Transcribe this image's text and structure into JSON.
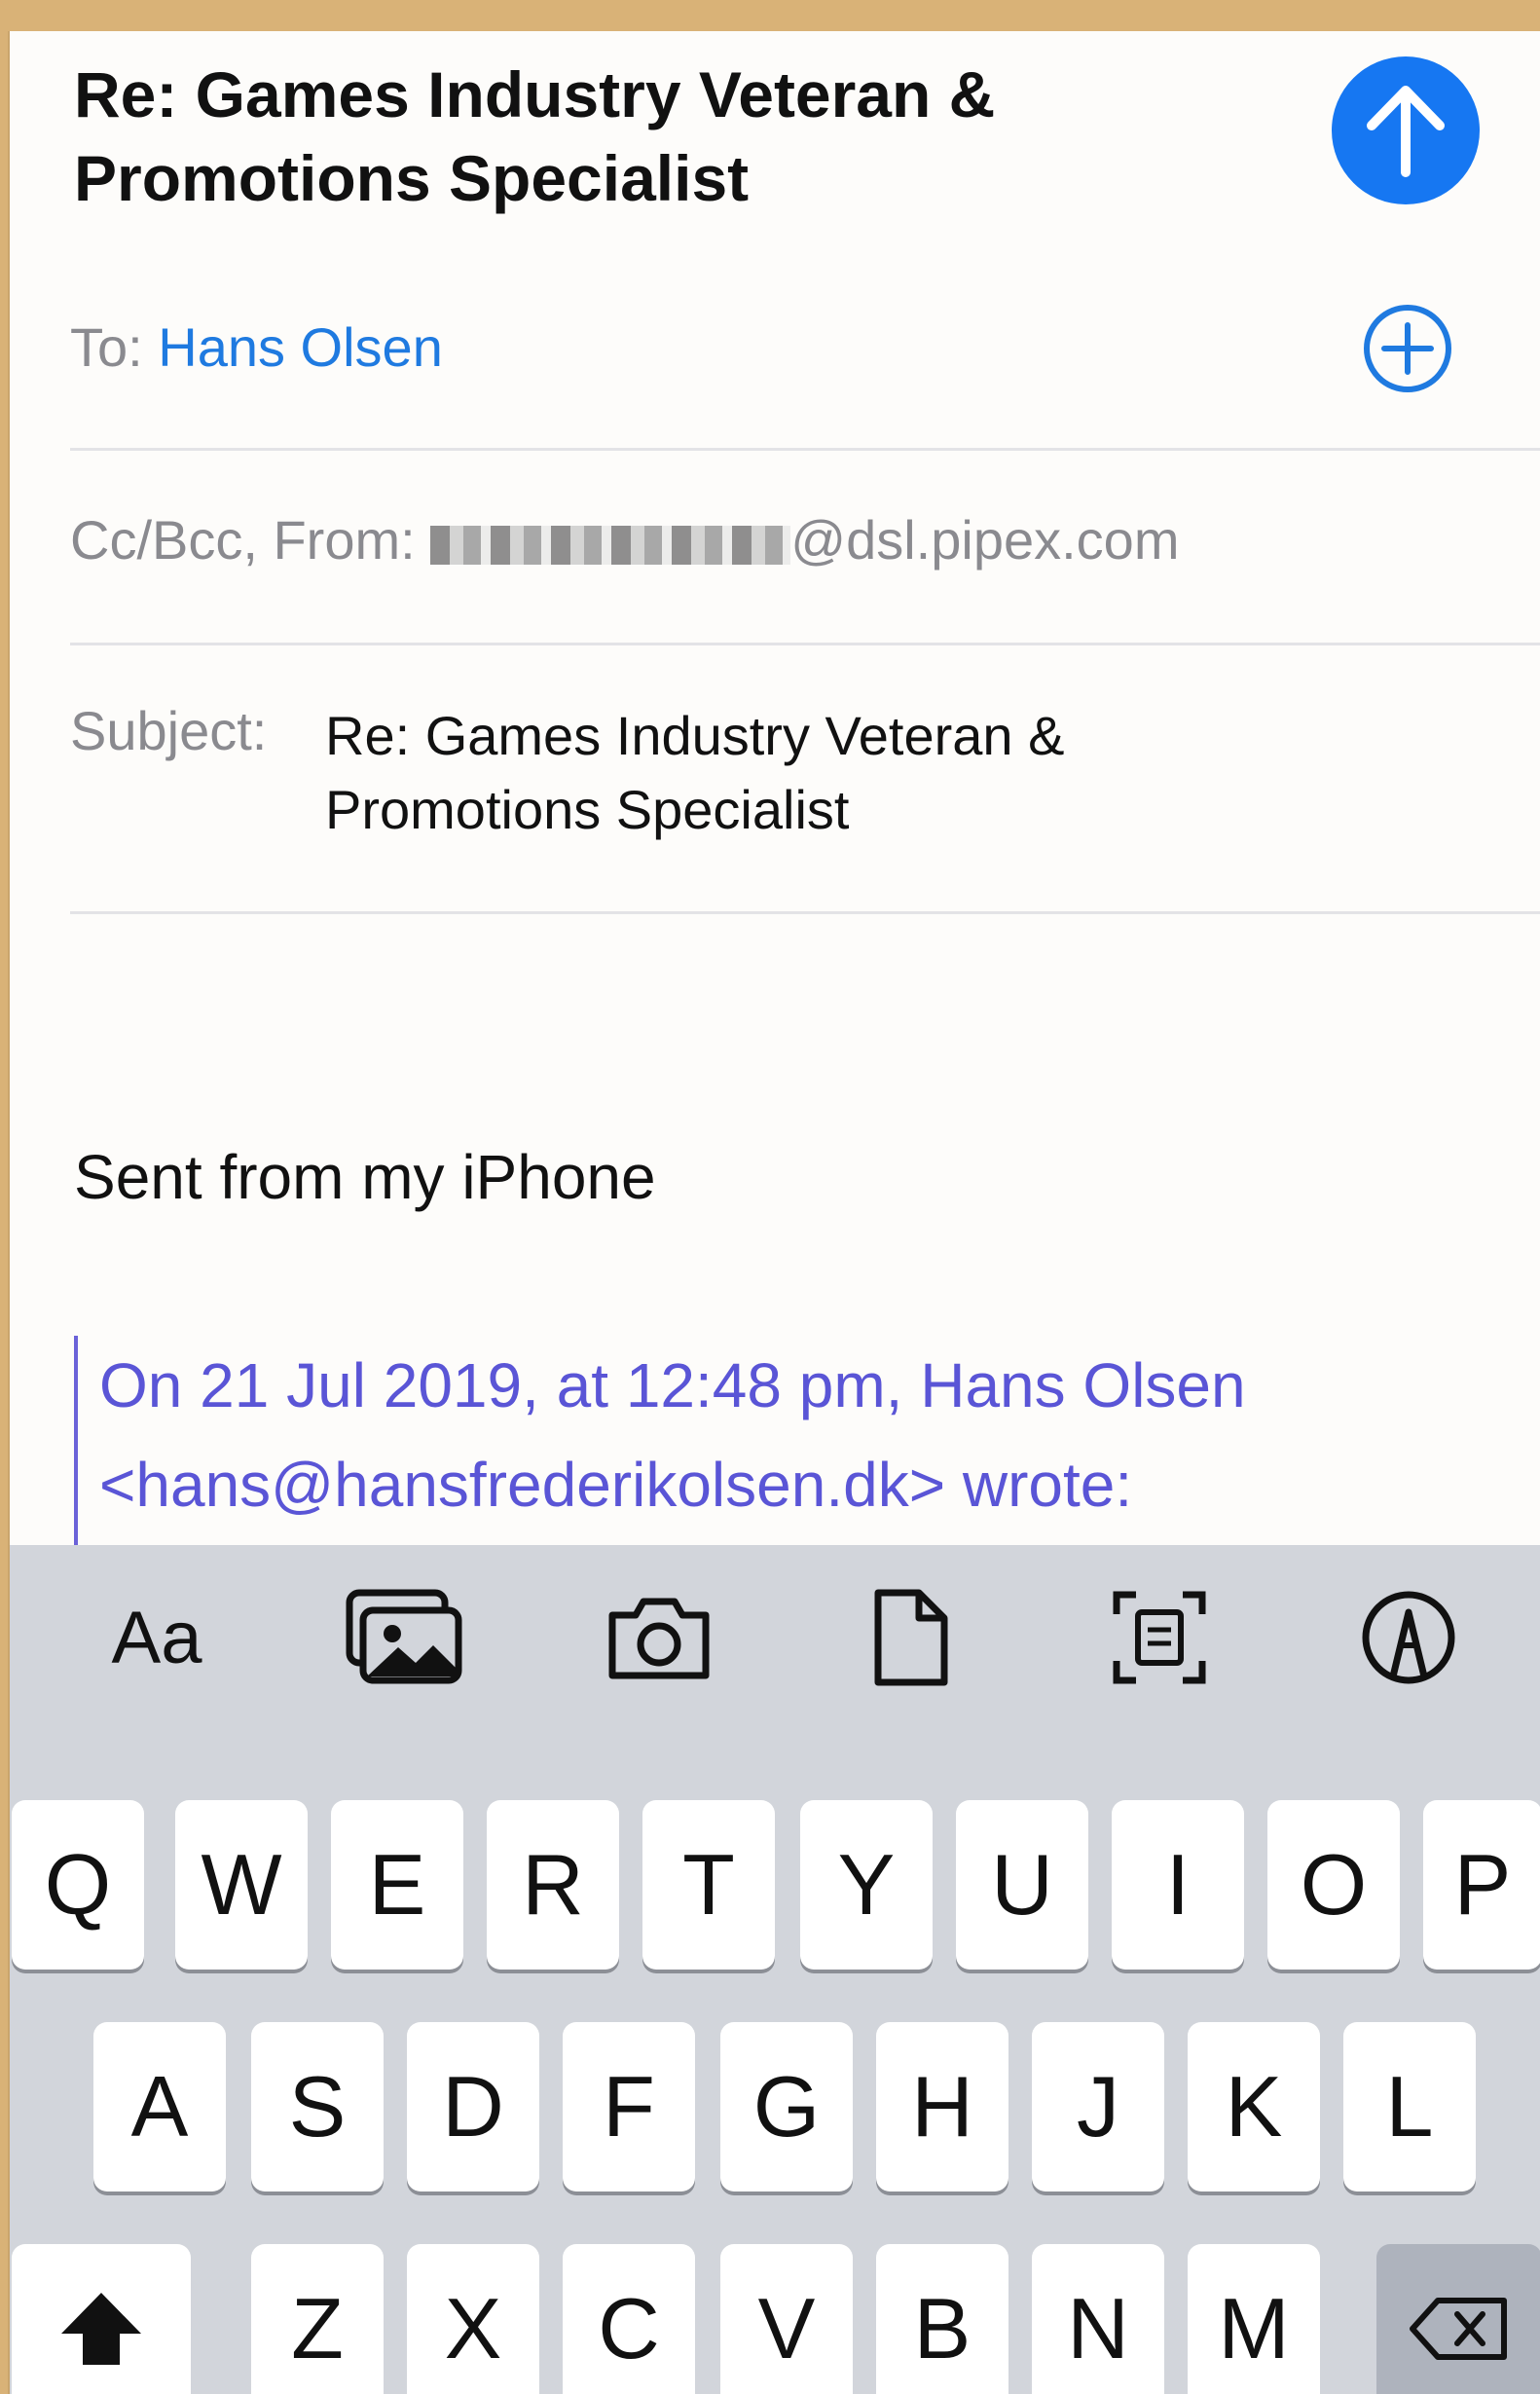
{
  "header": {
    "title": "Re: Games Industry Veteran & Promotions Specialist",
    "send_icon": "arrow-up-icon"
  },
  "to": {
    "label": "To:",
    "value": "Hans Olsen",
    "add_icon": "plus-circle-icon"
  },
  "cc": {
    "label": "Cc/Bcc, From:",
    "email_suffix": "@dsl.pipex.com"
  },
  "subject": {
    "label": "Subject:",
    "value": "Re: Games Industry Veteran & Promotions Specialist"
  },
  "body": {
    "signature": "Sent from my iPhone",
    "quote_line1": "On 21 Jul 2019, at 12:48 pm, Hans Olsen",
    "quote_line2": "<hans@hansfrederikolsen.dk> wrote:"
  },
  "toolbar": {
    "format_label": "Aa",
    "icons": [
      "photo-library-icon",
      "camera-icon",
      "document-icon",
      "scan-document-icon",
      "markup-icon"
    ]
  },
  "keyboard": {
    "row1": [
      "Q",
      "W",
      "E",
      "R",
      "T",
      "Y",
      "U",
      "I",
      "O",
      "P"
    ],
    "row2": [
      "A",
      "S",
      "D",
      "F",
      "G",
      "H",
      "J",
      "K",
      "L"
    ],
    "row3": [
      "Z",
      "X",
      "C",
      "V",
      "B",
      "N",
      "M"
    ],
    "shift_icon": "shift-icon",
    "delete_icon": "delete-backspace-icon"
  },
  "colors": {
    "accent": "#1677f2",
    "link": "#1f7ae0",
    "quote": "#5a55d6",
    "keyboard_bg": "#d2d5db"
  }
}
